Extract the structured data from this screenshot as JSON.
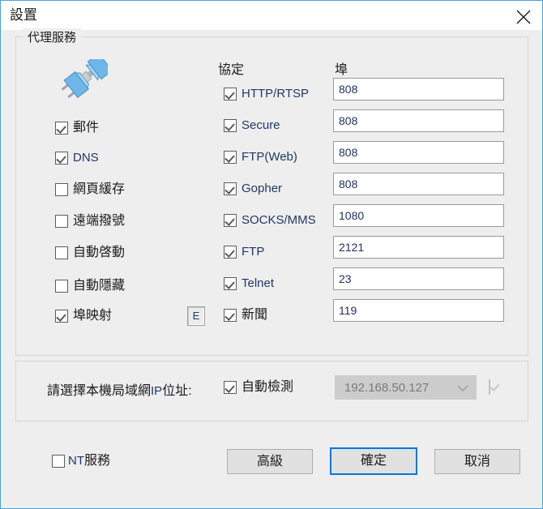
{
  "window": {
    "title": "設置",
    "close_icon": "close-icon",
    "border_color": "#4ba3d3"
  },
  "proxy_group": {
    "title": "代理服務",
    "icon": "network-plug-icon",
    "services": [
      {
        "label": "郵件",
        "checked": true,
        "latin": false
      },
      {
        "label": "DNS",
        "checked": true,
        "latin": true
      },
      {
        "label": "網頁緩存",
        "checked": false,
        "latin": false
      },
      {
        "label": "遠端撥號",
        "checked": false,
        "latin": false
      },
      {
        "label": "自動啓動",
        "checked": false,
        "latin": false
      },
      {
        "label": "自動隱藏",
        "checked": false,
        "latin": false
      },
      {
        "label": "埠映射",
        "checked": true,
        "latin": false
      }
    ],
    "e_button_label": "E",
    "protocol_header": "協定",
    "port_header": "埠",
    "protocols": [
      {
        "label": "HTTP/RTSP",
        "checked": true,
        "latin": true,
        "port": "808"
      },
      {
        "label": "Secure",
        "checked": true,
        "latin": true,
        "port": "808"
      },
      {
        "label": "FTP(Web)",
        "checked": true,
        "latin": true,
        "port": "808"
      },
      {
        "label": "Gopher",
        "checked": true,
        "latin": true,
        "port": "808"
      },
      {
        "label": "SOCKS/MMS",
        "checked": true,
        "latin": true,
        "port": "1080"
      },
      {
        "label": "FTP",
        "checked": true,
        "latin": true,
        "port": "2121"
      },
      {
        "label": "Telnet",
        "checked": true,
        "latin": true,
        "port": "23"
      },
      {
        "label": "新聞",
        "checked": true,
        "latin": false,
        "port": "119"
      }
    ]
  },
  "ip_group": {
    "label_prefix": "請選擇本機局域網",
    "label_latin": "IP",
    "label_suffix": "位址:",
    "auto_detect_label": "自動檢測",
    "auto_detect_checked": true,
    "selected_ip": "192.168.50.127",
    "dropdown_icon": "chevron-down-icon",
    "dropdown_disabled": true,
    "extra_checkbox_checked": true,
    "extra_checkbox_disabled": true
  },
  "footer": {
    "nt_service_latin": "NT",
    "nt_service_label": "服務",
    "nt_service_checked": false,
    "advanced_label": "高級",
    "ok_label": "確定",
    "cancel_label": "取消",
    "focus_color": "#0078d7"
  }
}
